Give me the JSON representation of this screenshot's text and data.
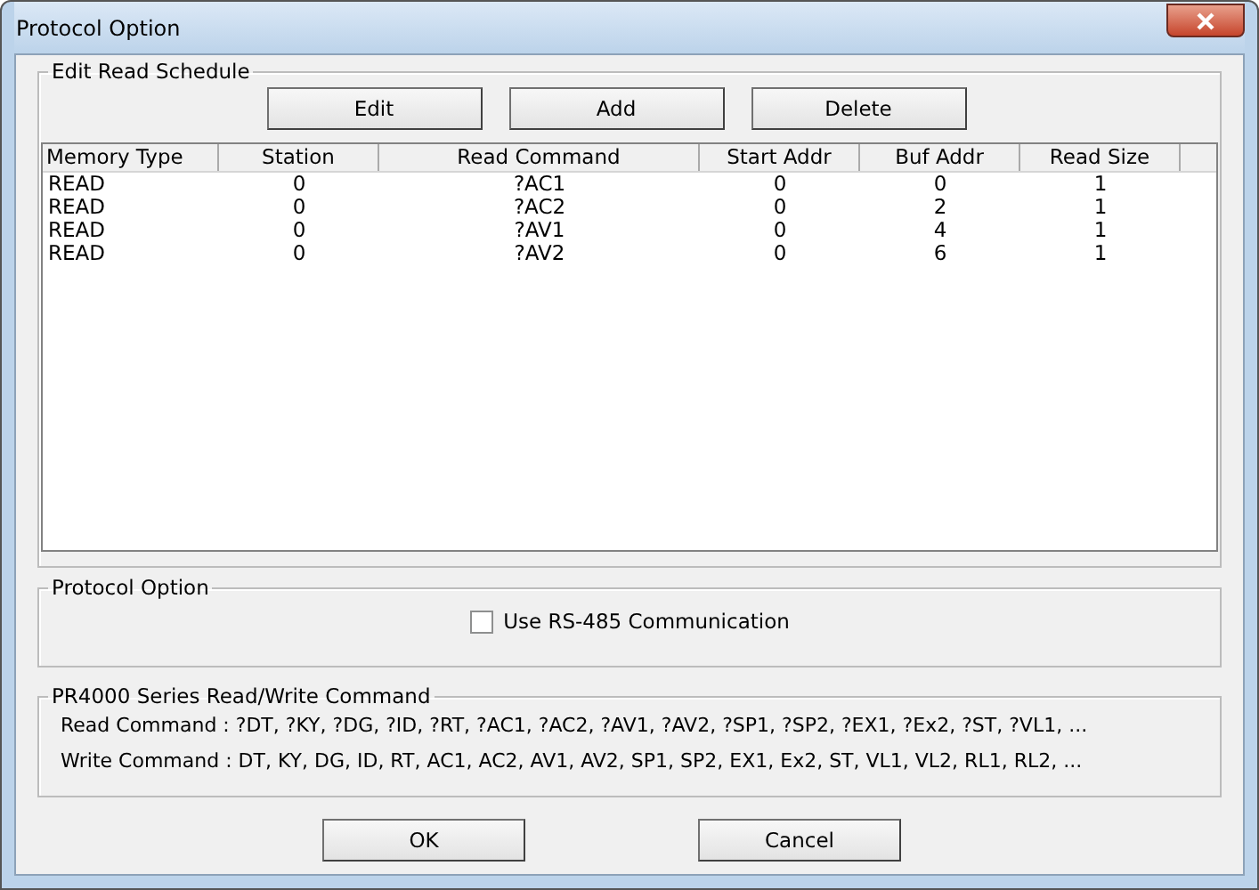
{
  "window": {
    "title": "Protocol Option"
  },
  "schedule": {
    "title": "Edit Read Schedule",
    "buttons": [
      "Edit",
      "Add",
      "Delete"
    ],
    "columns": [
      "Memory Type",
      "Station",
      "Read Command",
      "Start Addr",
      "Buf Addr",
      "Read Size"
    ],
    "rows": [
      [
        "READ",
        "0",
        "?AC1",
        "0",
        "0",
        "1"
      ],
      [
        "READ",
        "0",
        "?AC2",
        "0",
        "2",
        "1"
      ],
      [
        "READ",
        "0",
        "?AV1",
        "0",
        "4",
        "1"
      ],
      [
        "READ",
        "0",
        "?AV2",
        "0",
        "6",
        "1"
      ]
    ]
  },
  "protocol": {
    "title": "Protocol Option",
    "checkbox": {
      "label": "Use RS-485 Communication",
      "checked": false
    }
  },
  "commands": {
    "title": "PR4000 Series Read/Write Command",
    "lines": [
      "Read Command : ?DT, ?KY, ?DG, ?ID, ?RT, ?AC1, ?AC2, ?AV1, ?AV2, ?SP1, ?SP2, ?EX1, ?Ex2, ?ST, ?VL1,  ...",
      "Write Command : DT, KY, DG, ID, RT, AC1, AC2, AV1, AV2, SP1, SP2, EX1, Ex2, ST, VL1, VL2, RL1, RL2, ..."
    ]
  },
  "buttons": [
    "OK",
    "Cancel"
  ]
}
